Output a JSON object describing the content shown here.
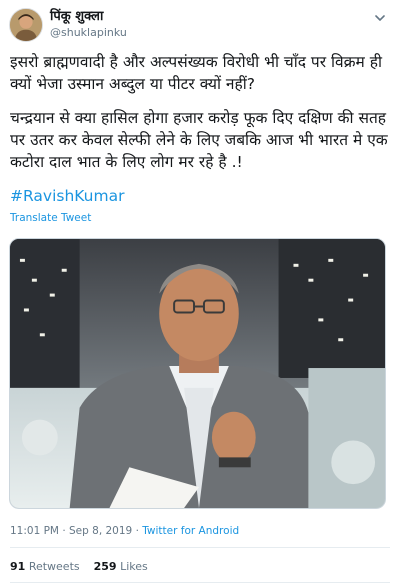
{
  "user": {
    "display_name": "पिंकू शुक्ला",
    "handle": "@shuklapinku"
  },
  "tweet": {
    "paragraph_1": "इसरो ब्राह्मणवादी है और अल्पसंख्यक विरोधी भी चाँद पर विक्रम ही क्यों भेजा उस्मान अब्दुल या पीटर क्यों नहीं?",
    "paragraph_2": "चन्द्रयान से क्या हासिल होगा हजार करोड़ फूक दिए दक्षिण की सतह पर उतर कर केवल सेल्फी लेने के लिए जबकि आज भी भारत मे एक कटोरा दाल भात के लिए लोग मर रहे है .!",
    "hashtag": "#RavishKumar",
    "translate_label": "Translate Tweet"
  },
  "meta": {
    "time": "11:01 PM",
    "separator": " · ",
    "date": "Sep 8, 2019",
    "source": "Twitter for Android"
  },
  "stats": {
    "retweets_count": "91",
    "retweets_label": "Retweets",
    "likes_count": "259",
    "likes_label": "Likes"
  },
  "icons": {
    "more": "chevron-down-icon"
  },
  "colors": {
    "link": "#1b95e0",
    "secondary_text": "#657786",
    "primary_text": "#14171a"
  }
}
